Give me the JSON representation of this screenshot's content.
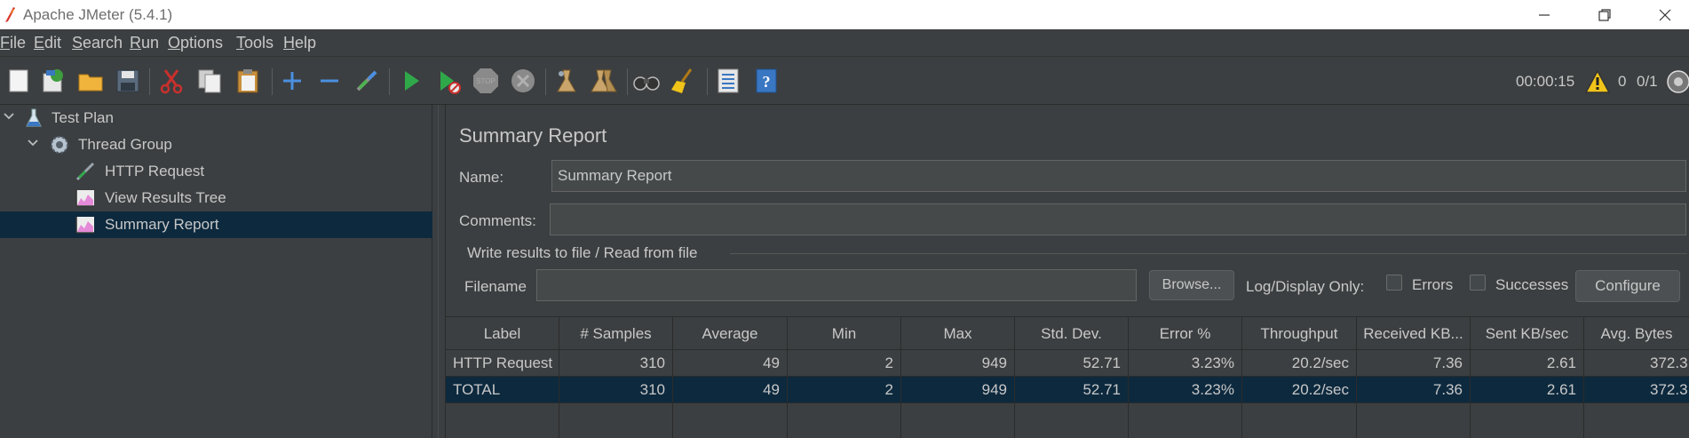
{
  "window": {
    "title": "Apache JMeter (5.4.1)",
    "minimize_glyph": "—",
    "maximize_glyph": "❐",
    "close_glyph": "✕"
  },
  "menu": {
    "items": [
      {
        "label": "File",
        "mnemonic": "F",
        "rest": "ile"
      },
      {
        "label": "Edit",
        "mnemonic": "E",
        "rest": "dit"
      },
      {
        "label": "Search",
        "mnemonic": "S",
        "rest": "earch"
      },
      {
        "label": "Run",
        "mnemonic": "R",
        "rest": "un"
      },
      {
        "label": "Options",
        "mnemonic": "O",
        "rest": "ptions"
      },
      {
        "label": "Tools",
        "mnemonic": "T",
        "rest": "ools"
      },
      {
        "label": "Help",
        "mnemonic": "H",
        "rest": "elp"
      }
    ]
  },
  "toolbar": {
    "icons": [
      "new-icon",
      "templates-icon",
      "open-icon",
      "save-icon",
      "cut-icon",
      "copy-icon",
      "paste-icon",
      "expand-icon",
      "collapse-icon",
      "toggle-icon",
      "start-icon",
      "start-no-pauses-icon",
      "stop-icon",
      "shutdown-icon",
      "clear-icon",
      "clear-all-icon",
      "search-icon",
      "reset-search-icon",
      "function-helper-icon",
      "help-icon"
    ],
    "timer": "00:00:15",
    "warning_count": "0",
    "threads": "0/1"
  },
  "tree": {
    "items": [
      {
        "label": "Test Plan",
        "icon": "test-plan-icon"
      },
      {
        "label": "Thread Group",
        "icon": "thread-group-icon"
      },
      {
        "label": "HTTP Request",
        "icon": "http-request-icon"
      },
      {
        "label": "View Results Tree",
        "icon": "listener-icon"
      },
      {
        "label": "Summary Report",
        "icon": "listener-icon"
      }
    ]
  },
  "panel": {
    "title": "Summary Report",
    "name_label": "Name:",
    "name_value": "Summary Report",
    "comments_label": "Comments:",
    "comments_value": "",
    "file_group_title": "Write results to file / Read from file",
    "filename_label": "Filename",
    "filename_value": "",
    "browse_label": "Browse...",
    "log_display_label": "Log/Display Only:",
    "errors_label": "Errors",
    "successes_label": "Successes",
    "configure_label": "Configure"
  },
  "table": {
    "headers": [
      "Label",
      "# Samples",
      "Average",
      "Min",
      "Max",
      "Std. Dev.",
      "Error %",
      "Throughput",
      "Received KB...",
      "Sent KB/sec",
      "Avg. Bytes"
    ],
    "rows": [
      [
        "HTTP Request",
        "310",
        "49",
        "2",
        "949",
        "52.71",
        "3.23%",
        "20.2/sec",
        "7.36",
        "2.61",
        "372.3"
      ],
      [
        "TOTAL",
        "310",
        "49",
        "2",
        "949",
        "52.71",
        "3.23%",
        "20.2/sec",
        "7.36",
        "2.61",
        "372.3"
      ]
    ]
  },
  "colors": {
    "background": "#3c3f41",
    "selection": "#0d293e",
    "text": "#c8c8c8"
  }
}
